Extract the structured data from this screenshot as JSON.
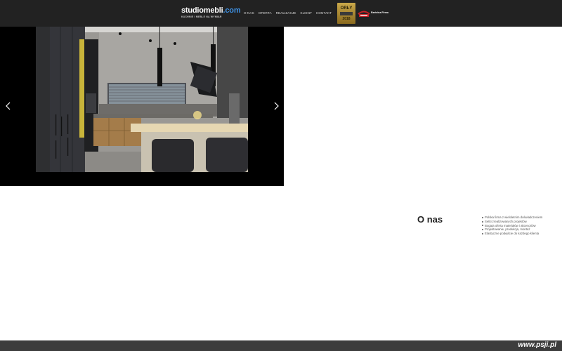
{
  "header": {
    "logo": {
      "main": "studiomebli",
      "domain": ".com",
      "tagline": "KUCHNIE I MEBLE NA WYMIAR"
    },
    "nav": [
      {
        "label": "O nas"
      },
      {
        "label": "Oferta"
      },
      {
        "label": "Realizacje"
      },
      {
        "label": "Klient"
      },
      {
        "label": "Kontakt"
      }
    ],
    "badges": {
      "orly_label": "ORŁY",
      "orly_year": "2018",
      "firma_label": "Rzetelna Firma"
    }
  },
  "slider": {
    "prev_icon": "chevron-left-icon",
    "next_icon": "chevron-right-icon",
    "image": "modern-kitchen-photo"
  },
  "about": {
    "title": "O nas",
    "items": [
      "Polska firma z wieloletnim doświadczeniem",
      "Setki zrealizowanych projektów",
      "Bogata oferta materiałów i akcesoriów",
      "Projektowanie, produkcja, montaż",
      "Elastyczne podejście do każdego klienta"
    ]
  },
  "footer": {
    "watermark": "www.psji.pl"
  },
  "colors": {
    "header_bg": "#222222",
    "accent": "#3d8fe0",
    "footer_bg": "#3c3c3c"
  }
}
